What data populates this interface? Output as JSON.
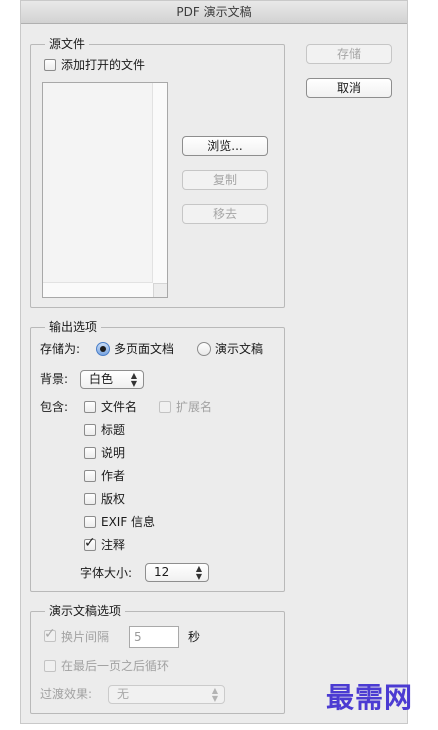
{
  "window": {
    "title": "PDF 演示文稿"
  },
  "buttons": {
    "save": "存储",
    "cancel": "取消"
  },
  "source": {
    "legend": "源文件",
    "add_open_files": "添加打开的文件",
    "browse": "浏览...",
    "duplicate": "复制",
    "remove": "移去"
  },
  "output": {
    "legend": "输出选项",
    "save_as_label": "存储为:",
    "save_as_options": [
      "多页面文档",
      "演示文稿"
    ],
    "save_as_selected": "多页面文档",
    "background_label": "背景:",
    "background_value": "白色",
    "include_label": "包含:",
    "include": {
      "filename": "文件名",
      "extension": "扩展名",
      "title": "标题",
      "description": "说明",
      "author": "作者",
      "copyright": "版权",
      "exif": "EXIF 信息",
      "notes": "注释"
    },
    "include_checked": [
      "注释"
    ],
    "font_size_label": "字体大小:",
    "font_size_value": "12"
  },
  "presentation": {
    "legend": "演示文稿选项",
    "advance_label": "换片间隔",
    "advance_value": "5",
    "advance_unit": "秒",
    "loop_label": "在最后一页之后循环",
    "transition_label": "过渡效果:",
    "transition_value": "无"
  },
  "watermark": "最需网",
  "icons": {
    "checkmark": "checkmark-icon",
    "stepper": "up-down-arrows-icon"
  }
}
